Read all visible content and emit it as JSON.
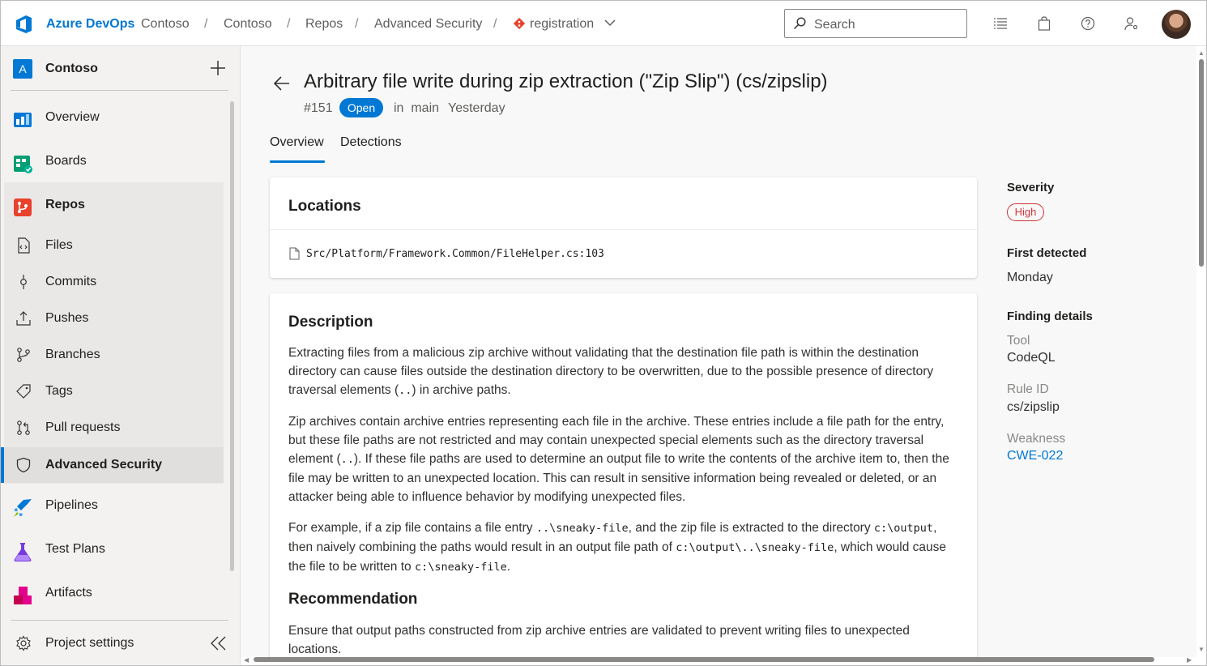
{
  "topbar": {
    "brand": "Azure DevOps",
    "breadcrumbs": [
      "Contoso",
      "Contoso",
      "Repos",
      "Advanced Security",
      "registration"
    ],
    "separator": "/",
    "search_placeholder": "Search",
    "icons": [
      "azure-devops-logo",
      "repo-icon",
      "chevron-down-icon",
      "search-icon",
      "list-icon",
      "shopping-bag-icon",
      "help-icon",
      "user-settings-icon",
      "avatar"
    ]
  },
  "sidebar": {
    "project_avatar": "A",
    "project_name": "Contoso",
    "items": [
      {
        "label": "Overview",
        "icon": "overview-icon"
      },
      {
        "label": "Boards",
        "icon": "boards-icon"
      },
      {
        "label": "Repos",
        "icon": "repos-icon"
      },
      {
        "label": "Files",
        "icon": "files-icon"
      },
      {
        "label": "Commits",
        "icon": "commits-icon"
      },
      {
        "label": "Pushes",
        "icon": "pushes-icon"
      },
      {
        "label": "Branches",
        "icon": "branches-icon"
      },
      {
        "label": "Tags",
        "icon": "tags-icon"
      },
      {
        "label": "Pull requests",
        "icon": "pull-requests-icon"
      },
      {
        "label": "Advanced Security",
        "icon": "shield-icon"
      },
      {
        "label": "Pipelines",
        "icon": "pipelines-icon"
      },
      {
        "label": "Test Plans",
        "icon": "test-plans-icon"
      },
      {
        "label": "Artifacts",
        "icon": "artifacts-icon"
      }
    ],
    "settings_label": "Project settings"
  },
  "alert": {
    "title": "Arbitrary file write during zip extraction (\"Zip Slip\") (cs/zipslip)",
    "id": "#151",
    "status": "Open",
    "branch_text": "in  main",
    "time": "Yesterday",
    "tabs": [
      "Overview",
      "Detections"
    ]
  },
  "locations": {
    "heading": "Locations",
    "path": "Src/Platform/Framework.Common/FileHelper.cs:103"
  },
  "description": {
    "heading": "Description",
    "p1_a": "Extracting files from a malicious zip archive without validating that the destination file path is within the destination directory can cause files outside the destination directory to be overwritten, due to the possible presence of directory traversal elements (",
    "p1_code": "..",
    "p1_b": ") in archive paths.",
    "p2_a": "Zip archives contain archive entries representing each file in the archive. These entries include a file path for the entry, but these file paths are not restricted and may contain unexpected special elements such as the directory traversal element (",
    "p2_code": "..",
    "p2_b": "). If these file paths are used to determine an output file to write the contents of the archive item to, then the file may be written to an unexpected location. This can result in sensitive information being revealed or deleted, or an attacker being able to influence behavior by modifying unexpected files.",
    "p3_a": "For example, if a zip file contains a file entry ",
    "p3_code1": "..\\sneaky-file",
    "p3_b": ", and the zip file is extracted to the directory ",
    "p3_code2": "c:\\output",
    "p3_c": ", then naively combining the paths would result in an output file path of ",
    "p3_code3": "c:\\output\\..\\sneaky-file",
    "p3_d": ", which would cause the file to be written to ",
    "p3_code4": "c:\\sneaky-file",
    "p3_e": ".",
    "rec_heading": "Recommendation",
    "rec_text": "Ensure that output paths constructed from zip archive entries are validated to prevent writing files to unexpected locations."
  },
  "details": {
    "severity_label": "Severity",
    "severity_value": "High",
    "first_detected_label": "First detected",
    "first_detected_value": "Monday",
    "finding_label": "Finding details",
    "tool_label": "Tool",
    "tool_value": "CodeQL",
    "rule_label": "Rule ID",
    "rule_value": "cs/zipslip",
    "weakness_label": "Weakness",
    "weakness_value": "CWE-022"
  },
  "colors": {
    "accent": "#0078d4",
    "severity_high": "#d13438",
    "sidebar_bg": "#f3f2f1"
  }
}
